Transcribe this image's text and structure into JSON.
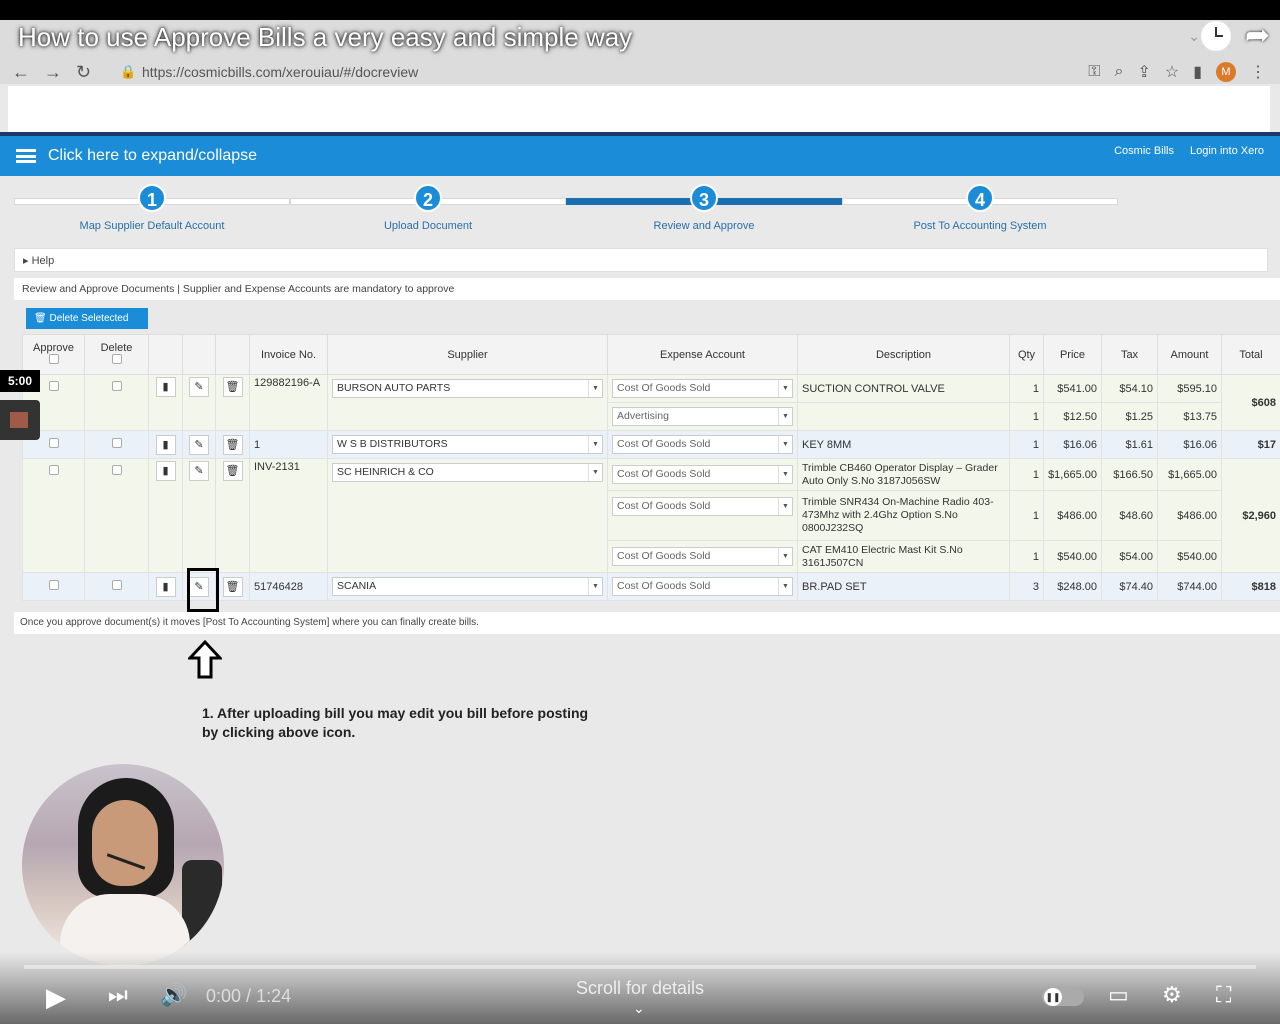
{
  "video": {
    "title": "How to use Approve Bills a very easy and simple way",
    "time_current": "0:00",
    "time_sep": " / ",
    "time_total": "1:24",
    "scroll_hint": "Scroll for details",
    "timer_badge": "5:00"
  },
  "browser": {
    "url": "https://cosmicbills.com/xerouiau/#/docreview",
    "profile_initial": "M"
  },
  "app": {
    "expand_label": "Click here to expand/collapse",
    "links": [
      "Cosmic Bills",
      "Login into Xero"
    ],
    "steps": [
      {
        "number": "1",
        "label": "Map Supplier Default Account"
      },
      {
        "number": "2",
        "label": "Upload Document"
      },
      {
        "number": "3",
        "label": "Review and Approve"
      },
      {
        "number": "4",
        "label": "Post To Accounting System"
      }
    ],
    "active_step": 3,
    "help_label": "Help",
    "info_text": "Review and Approve Documents | Supplier and Expense Accounts are mandatory to approve",
    "delete_button": "Delete Seletected",
    "footnote": "Once you approve document(s) it moves [Post To Accounting System] where you can finally create bills."
  },
  "table": {
    "headers": {
      "approve": "Approve",
      "delete": "Delete",
      "invoice": "Invoice No.",
      "supplier": "Supplier",
      "expense": "Expense Account",
      "description": "Description",
      "qty": "Qty",
      "price": "Price",
      "tax": "Tax",
      "amount": "Amount",
      "total": "Total"
    },
    "invoices": [
      {
        "invoice": "129882196-A",
        "supplier": "BURSON AUTO PARTS",
        "total": "$608",
        "lines": [
          {
            "account": "Cost Of Goods Sold",
            "description": "SUCTION CONTROL VALVE",
            "qty": "1",
            "price": "$541.00",
            "tax": "$54.10",
            "amount": "$595.10"
          },
          {
            "account": "Advertising",
            "description": "",
            "qty": "1",
            "price": "$12.50",
            "tax": "$1.25",
            "amount": "$13.75"
          }
        ]
      },
      {
        "invoice": "1",
        "supplier": "W S B DISTRIBUTORS",
        "total": "$17",
        "lines": [
          {
            "account": "Cost Of Goods Sold",
            "description": "KEY 8MM",
            "qty": "1",
            "price": "$16.06",
            "tax": "$1.61",
            "amount": "$16.06"
          }
        ]
      },
      {
        "invoice": "INV-2131",
        "supplier": "SC HEINRICH & CO",
        "total": "$2,960",
        "lines": [
          {
            "account": "Cost Of Goods Sold",
            "description": "Trimble CB460 Operator Display – Grader Auto Only S.No 3187J056SW",
            "qty": "1",
            "price": "$1,665.00",
            "tax": "$166.50",
            "amount": "$1,665.00"
          },
          {
            "account": "Cost Of Goods Sold",
            "description": "Trimble SNR434 On-Machine Radio 403-473Mhz with 2.4Ghz Option S.No 0800J232SQ",
            "qty": "1",
            "price": "$486.00",
            "tax": "$48.60",
            "amount": "$486.00"
          },
          {
            "account": "Cost Of Goods Sold",
            "description": "CAT EM410 Electric Mast Kit S.No 3161J507CN",
            "qty": "1",
            "price": "$540.00",
            "tax": "$54.00",
            "amount": "$540.00"
          }
        ]
      },
      {
        "invoice": "51746428",
        "supplier": "SCANIA",
        "total": "$818",
        "lines": [
          {
            "account": "Cost Of Goods Sold",
            "description": "BR.PAD SET",
            "qty": "3",
            "price": "$248.00",
            "tax": "$74.40",
            "amount": "$744.00"
          }
        ]
      }
    ]
  },
  "annotation": {
    "line1": "1. After uploading bill you may edit you bill before posting",
    "line2": "by clicking above icon."
  },
  "colors": {
    "appbar": "#1a8cd8",
    "step_active": "#1a6fb0",
    "link_text": "#2a6fa8"
  }
}
